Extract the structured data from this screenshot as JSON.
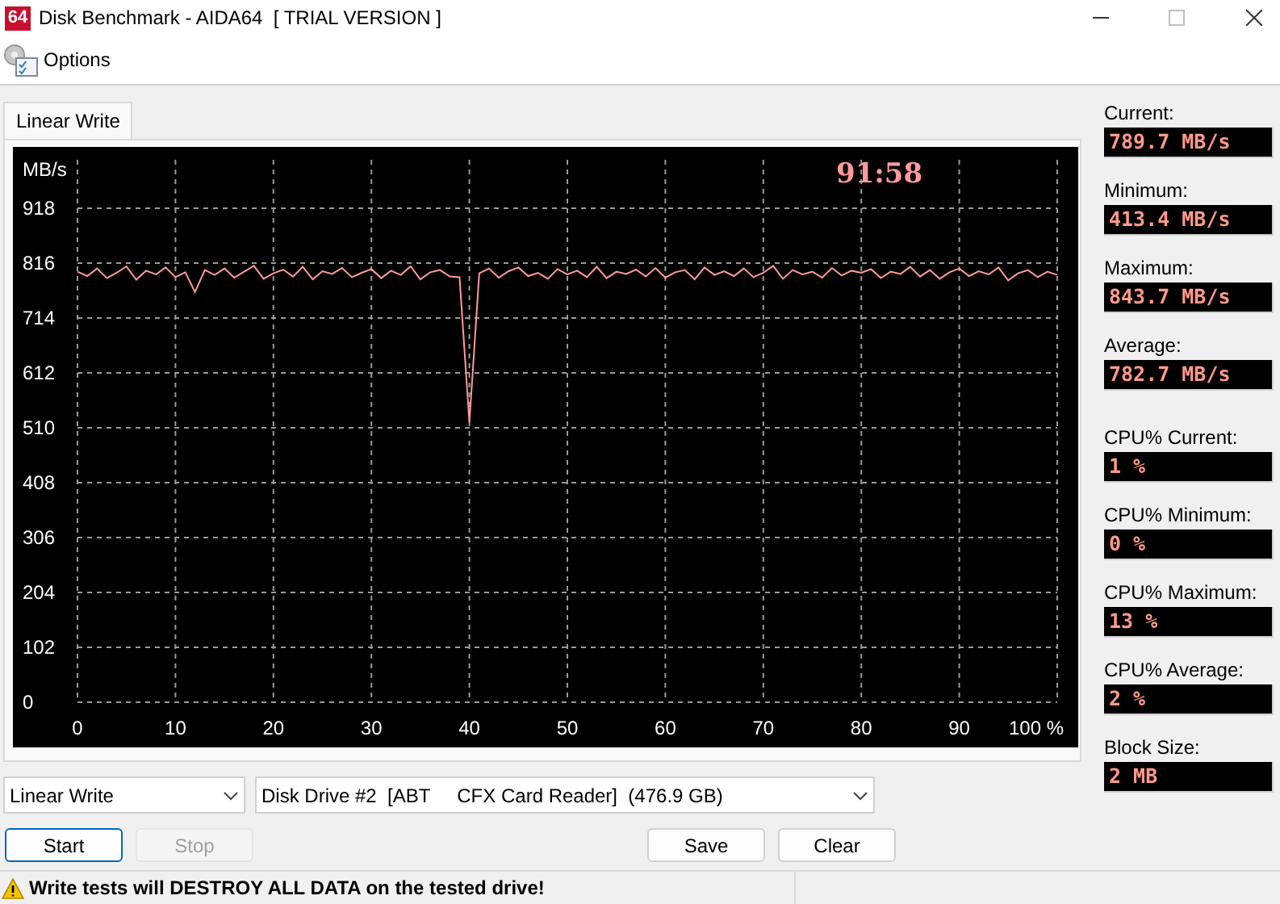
{
  "window": {
    "app_icon_text": "64",
    "title": "Disk Benchmark - AIDA64  [ TRIAL VERSION ]"
  },
  "toolbar": {
    "items": [
      {
        "label": "Options"
      }
    ]
  },
  "tabs": [
    {
      "label": "Linear Write",
      "selected": true
    }
  ],
  "chart_panel": {
    "timer": "91:58",
    "chart_data": {
      "type": "line",
      "ylabel": "MB/s",
      "xlim": [
        0,
        100
      ],
      "ylim": [
        0,
        918
      ],
      "xticks": [
        0,
        10,
        20,
        30,
        40,
        50,
        60,
        70,
        80,
        90,
        {
          "value": 100,
          "label": "100 %"
        }
      ],
      "yticks": [
        0,
        102,
        204,
        306,
        408,
        510,
        612,
        714,
        816,
        918
      ],
      "x": [
        0,
        1,
        2,
        3,
        4,
        5,
        6,
        7,
        8,
        9,
        10,
        11,
        12,
        13,
        14,
        15,
        16,
        17,
        18,
        19,
        20,
        21,
        22,
        23,
        24,
        25,
        26,
        27,
        28,
        29,
        30,
        31,
        32,
        33,
        34,
        35,
        36,
        37,
        38,
        39,
        40,
        41,
        42,
        43,
        44,
        45,
        46,
        47,
        48,
        49,
        50,
        51,
        52,
        53,
        54,
        55,
        56,
        57,
        58,
        59,
        60,
        61,
        62,
        63,
        64,
        65,
        66,
        67,
        68,
        69,
        70,
        71,
        72,
        73,
        74,
        75,
        76,
        77,
        78,
        79,
        80,
        81,
        82,
        83,
        84,
        85,
        86,
        87,
        88,
        89,
        90,
        91,
        92,
        93,
        94,
        95,
        96,
        97,
        98,
        99,
        100
      ],
      "grid": true,
      "series": [
        {
          "color": "#ff9a9a",
          "values": [
            800,
            792,
            806,
            788,
            798,
            810,
            785,
            802,
            795,
            808,
            790,
            799,
            762,
            803,
            794,
            806,
            789,
            800,
            811,
            787,
            797,
            804,
            791,
            809,
            786,
            801,
            796,
            807,
            790,
            798,
            805,
            788,
            802,
            794,
            810,
            786,
            799,
            803,
            791,
            790,
            520,
            797,
            806,
            789,
            801,
            808,
            792,
            798,
            787,
            805,
            795,
            802,
            790,
            809,
            788,
            800,
            796,
            804,
            791,
            807,
            789,
            799,
            803,
            786,
            808,
            794,
            801,
            792,
            806,
            790,
            798,
            811,
            787,
            803,
            795,
            800,
            789,
            807,
            793,
            802,
            798,
            805,
            788,
            800,
            796,
            809,
            791,
            803,
            787,
            799,
            806,
            792,
            801,
            795,
            808,
            784,
            797,
            803,
            790,
            800,
            794
          ]
        }
      ]
    }
  },
  "speed_stats": [
    {
      "label": "Current:",
      "value": "789.7 MB/s"
    },
    {
      "label": "Minimum:",
      "value": "413.4 MB/s"
    },
    {
      "label": "Maximum:",
      "value": "843.7 MB/s"
    },
    {
      "label": "Average:",
      "value": "782.7 MB/s"
    }
  ],
  "cpu_stats": [
    {
      "label": "CPU% Current:",
      "value": "1 %"
    },
    {
      "label": "CPU% Minimum:",
      "value": "0 %"
    },
    {
      "label": "CPU% Maximum:",
      "value": "13 %"
    },
    {
      "label": "CPU% Average:",
      "value": "2 %"
    },
    {
      "label": "Block Size:",
      "value": "2 MB"
    }
  ],
  "test_select": {
    "value": "Linear Write"
  },
  "drive_select": {
    "value": "Disk Drive #2  [ABT     CFX Card Reader]  (476.9 GB)"
  },
  "left_buttons": [
    {
      "label": "Start",
      "default": true,
      "disabled": false
    },
    {
      "label": "Stop",
      "default": false,
      "disabled": true
    }
  ],
  "right_buttons": [
    {
      "label": "Save",
      "default": false,
      "disabled": false
    },
    {
      "label": "Clear",
      "default": false,
      "disabled": false
    }
  ],
  "status_bar": {
    "warning": "Write tests will DESTROY ALL DATA on the tested drive!"
  }
}
